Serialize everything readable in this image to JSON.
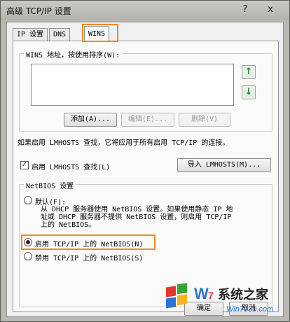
{
  "window": {
    "title": "高级 TCP/IP 设置",
    "help_glyph": "?",
    "close_glyph": "x"
  },
  "tabs": [
    {
      "label": "IP 设置",
      "active": false
    },
    {
      "label": "DNS",
      "active": false
    },
    {
      "label": "WINS",
      "active": true
    }
  ],
  "wins": {
    "group_label": "WINS 地址，按使用排序(W):",
    "addresses": [],
    "up_glyph": "↑",
    "down_glyph": "↓",
    "add_label": "添加(A)...",
    "edit_label": "编辑(E)...",
    "delete_label": "删除(V)",
    "lmhosts_note": "如果启用 LMHOSTS 查找，它将应用于所有启用 TCP/IP 的连接。",
    "enable_lmhosts_label": "启用 LMHOSTS 查找(L)",
    "enable_lmhosts_checked": true,
    "check_glyph": "✓",
    "import_label": "导入 LMHOSTS(M)..."
  },
  "netbios": {
    "group_label": "NetBIOS 设置",
    "default_label": "默认(F):",
    "default_desc_line1": "从 DHCP 服务器使用 NetBIOS 设置。如果使用静态 IP 地",
    "default_desc_line2": "址或 DHCP 服务器不提供 NetBIOS 设置，则启用 TCP/IP",
    "default_desc_line3": "上的 NetBIOS。",
    "enable_label": "启用 TCP/IP 上的 NetBIOS(N)",
    "disable_label": "禁用 TCP/IP 上的 NetBIOS(S)",
    "selected": "enable"
  },
  "footer": {
    "ok_label": "确定",
    "cancel_label": "取消"
  },
  "watermark": {
    "brand": "系统之家",
    "url": "Win7999.com",
    "colors": {
      "red": "#e8342a",
      "green": "#36a337",
      "blue": "#2a73d6",
      "yellow": "#f5b417"
    }
  },
  "accent": {
    "highlight": "#ee8a24",
    "arrow": "#1f8a3a"
  }
}
